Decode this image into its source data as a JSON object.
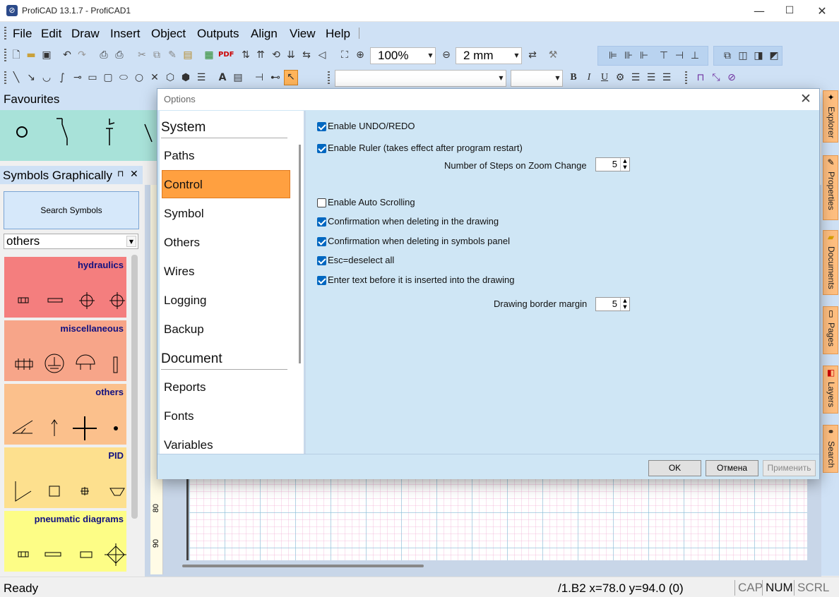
{
  "window": {
    "title": "ProfiCAD 13.1.7 - ProfiCAD1",
    "minimize": "—",
    "maximize": "☐",
    "close": "✕"
  },
  "menu": [
    "File",
    "Edit",
    "Draw",
    "Insert",
    "Object",
    "Outputs",
    "Align",
    "View",
    "Help"
  ],
  "toolbar": {
    "zoom": "100%",
    "grid": "2 mm",
    "pdf_label": "PDF"
  },
  "format_bar": {
    "bold": "B",
    "italic": "I",
    "underline": "U",
    "text_tool": "A"
  },
  "favourites": {
    "title": "Favourites"
  },
  "symbols_panel": {
    "title": "Symbols Graphically",
    "pin": "⊓",
    "close": "✕",
    "search_button": "Search Symbols",
    "category": "others",
    "categories": [
      {
        "label": "hydraulics",
        "color": "#f47e7e"
      },
      {
        "label": "miscellaneous",
        "color": "#f7a589"
      },
      {
        "label": "others",
        "color": "#fbc08c"
      },
      {
        "label": "PID",
        "color": "#fde08e"
      },
      {
        "label": "pneumatic diagrams",
        "color": "#fdfd86"
      }
    ]
  },
  "ruler": {
    "marks": [
      "80",
      "90"
    ]
  },
  "right_dock": [
    "Explorer",
    "Properties",
    "Documents",
    "Pages",
    "Layers",
    "Search"
  ],
  "status": {
    "text": "Ready",
    "coords": "/1.B2  x=78.0  y=94.0 (0)",
    "indicators": [
      "CAP",
      "NUM",
      "SCRL"
    ]
  },
  "dialog": {
    "title": "Options",
    "close": "✕",
    "nav": {
      "groups": [
        {
          "heading": "System",
          "items": [
            "Paths",
            "Control",
            "Symbol",
            "Others",
            "Wires",
            "Logging",
            "Backup"
          ]
        },
        {
          "heading": "Document",
          "items": [
            "Reports",
            "Fonts",
            "Variables"
          ]
        }
      ],
      "selected": "Control"
    },
    "options": [
      {
        "label": "Enable UNDO/REDO",
        "checked": true
      },
      {
        "label": "Enable Ruler (takes effect after program restart)",
        "checked": true
      },
      {
        "label": "Enable Auto Scrolling",
        "checked": false
      },
      {
        "label": "Confirmation when deleting in the drawing",
        "checked": true
      },
      {
        "label": "Confirmation when deleting in symbols panel",
        "checked": true
      },
      {
        "label": "Esc=deselect all",
        "checked": true
      },
      {
        "label": "Enter text before it is inserted into the drawing",
        "checked": true
      }
    ],
    "zoom_steps": {
      "label": "Number of Steps on Zoom Change",
      "value": "5"
    },
    "border_margin": {
      "label": "Drawing border margin",
      "value": "5"
    },
    "buttons": {
      "ok": "OK",
      "cancel": "Отмена",
      "apply": "Применить"
    }
  }
}
